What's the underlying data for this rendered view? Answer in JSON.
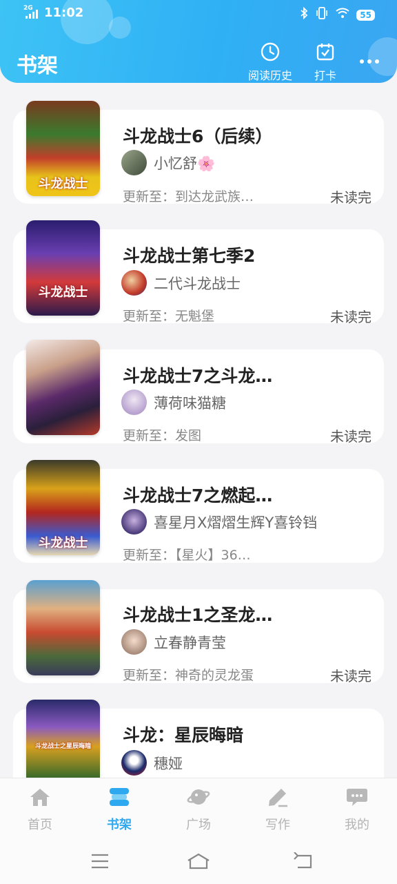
{
  "status_bar": {
    "network": "2G",
    "time": "11:02",
    "battery": "55"
  },
  "header": {
    "title": "书架",
    "history_label": "阅读历史",
    "checkin_label": "打卡"
  },
  "books": [
    {
      "title": "斗龙战士6（后续）",
      "author": "小忆舒🌸",
      "update": "更新至：到达龙武族…",
      "status": "未读完",
      "cover_text": "斗龙战士"
    },
    {
      "title": "斗龙战士第七季2",
      "author": "二代斗龙战士",
      "update": "更新至：无魁堡",
      "status": "未读完",
      "cover_text": "斗龙战士"
    },
    {
      "title": "斗龙战士7之斗龙…",
      "author": "薄荷味猫糖",
      "update": "更新至：发图",
      "status": "未读完",
      "cover_text": ""
    },
    {
      "title": "斗龙战士7之燃起…",
      "author": "喜星月X熠熠生辉Y喜铃铛",
      "update": "更新至：【星火】36…",
      "status": "",
      "cover_text": "斗龙战士"
    },
    {
      "title": "斗龙战士1之圣龙…",
      "author": "立春静青莹",
      "update": "更新至：神奇的灵龙蛋",
      "status": "未读完",
      "cover_text": ""
    },
    {
      "title": "斗龙：星辰晦暗",
      "author": "穗娅",
      "update": "",
      "status": "",
      "cover_text": "斗龙战士之星辰晦暗"
    }
  ],
  "tabs": [
    {
      "label": "首页",
      "icon": "home-icon"
    },
    {
      "label": "书架",
      "icon": "bookshelf-icon"
    },
    {
      "label": "广场",
      "icon": "planet-icon"
    },
    {
      "label": "写作",
      "icon": "pencil-icon"
    },
    {
      "label": "我的",
      "icon": "chat-bubble-icon"
    }
  ],
  "colors": {
    "accent": "#2ea9f0",
    "header_start": "#3ec3f5",
    "header_end": "#3aa6f2"
  }
}
